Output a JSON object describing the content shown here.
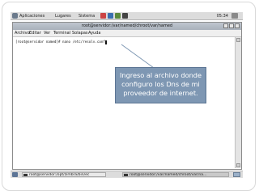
{
  "top_panel": {
    "menus": [
      "Aplicaciones",
      "Lugares",
      "Sistema"
    ],
    "clock": "05:34"
  },
  "window": {
    "title": "root@servidor:/var/named/chroot/var/named",
    "menus": [
      "Archivo",
      "Editar",
      "Ver",
      "Terminal",
      "Solapas",
      "Ayuda"
    ],
    "prompt": "[root@servidor named]# nano /etc/resolv.conf"
  },
  "callout": {
    "text": "Ingreso al archivo donde configuro los Dns de mi proveedor de internet."
  },
  "taskbar": {
    "tasks": [
      {
        "label": "root@servidor:/opt/zimbra/bin/ec",
        "active": false
      },
      {
        "label": "root@servidor:/var/named/chroot/var/na...",
        "active": true
      }
    ]
  }
}
